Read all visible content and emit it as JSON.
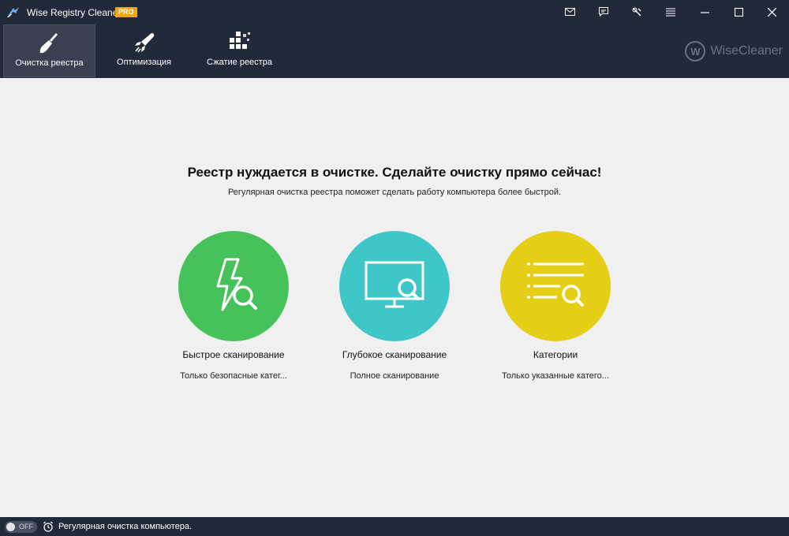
{
  "window": {
    "title": "Wise Registry Cleaner X",
    "badge": "PRO",
    "controls": [
      "mail-icon",
      "feedback-icon",
      "tools-icon",
      "menu-icon",
      "minimize-icon",
      "maximize-icon",
      "close-icon"
    ]
  },
  "tabs": [
    {
      "label": "Очистка реестра",
      "icon": "broom-icon",
      "active": true
    },
    {
      "label": "Оптимизация",
      "icon": "rocket-icon",
      "active": false
    },
    {
      "label": "Сжатие реестра",
      "icon": "compress-icon",
      "active": false
    }
  ],
  "brand": {
    "logo_letter": "W",
    "name": "WiseCleaner"
  },
  "main": {
    "headline": "Реестр нуждается в очистке. Сделайте очистку прямо сейчас!",
    "subline": "Регулярная очистка реестра поможет сделать работу компьютера более быстрой."
  },
  "scans": [
    {
      "title": "Быстрое сканирование",
      "desc": "Только безопасные катег...",
      "color": "#45c35a",
      "icon": "fast-scan-icon"
    },
    {
      "title": "Глубокое сканирование",
      "desc": "Полное сканирование",
      "color": "#3ec6c8",
      "icon": "deep-scan-icon"
    },
    {
      "title": "Категории",
      "desc": "Только указанные катего...",
      "color": "#e5cf16",
      "icon": "categories-icon"
    }
  ],
  "status": {
    "toggle_label": "OFF",
    "text": "Регулярная очистка компьютера."
  }
}
